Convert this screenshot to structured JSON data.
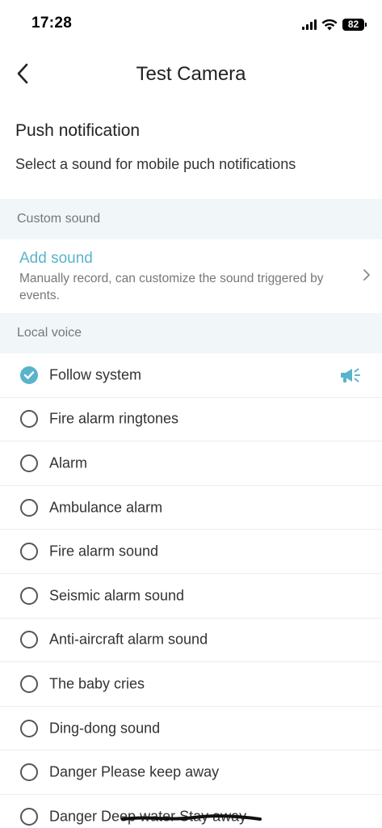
{
  "status_bar": {
    "time": "17:28",
    "battery": "82"
  },
  "header": {
    "title": "Test Camera"
  },
  "intro": {
    "heading": "Push notification",
    "description": "Select a sound for mobile puch notifications"
  },
  "custom_sound": {
    "group_label": "Custom sound",
    "add_title": "Add sound",
    "add_description": "Manually record, can customize the sound triggered by events."
  },
  "local_voice": {
    "group_label": "Local voice",
    "selected_index": 0,
    "items": [
      {
        "label": "Follow system",
        "selected": true
      },
      {
        "label": "Fire alarm ringtones",
        "selected": false
      },
      {
        "label": "Alarm",
        "selected": false
      },
      {
        "label": "Ambulance alarm",
        "selected": false
      },
      {
        "label": "Fire alarm sound",
        "selected": false
      },
      {
        "label": "Seismic alarm sound",
        "selected": false
      },
      {
        "label": "Anti-aircraft alarm sound",
        "selected": false
      },
      {
        "label": "The baby cries",
        "selected": false
      },
      {
        "label": "Ding-dong sound",
        "selected": false
      },
      {
        "label": "Danger Please keep away",
        "selected": false
      },
      {
        "label": "Danger Deep water Stay away",
        "selected": false
      }
    ]
  },
  "colors": {
    "accent": "#5ab3cc",
    "group_bg": "#f1f7f8"
  },
  "icons": {
    "back": "chevron-left-icon",
    "chevron": "chevron-right-icon",
    "speaker": "megaphone-icon",
    "check": "check-icon"
  }
}
